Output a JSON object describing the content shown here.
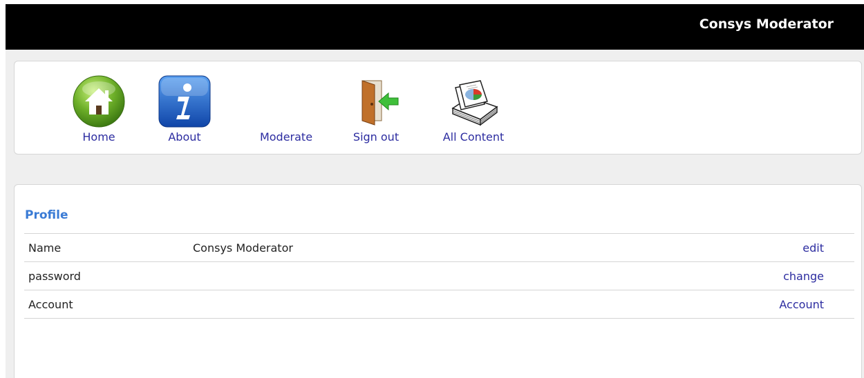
{
  "header": {
    "user_name": "Consys Moderator"
  },
  "nav": {
    "items": [
      {
        "label": "Home",
        "icon": "home-icon"
      },
      {
        "label": "About",
        "icon": "info-icon"
      },
      {
        "label": "Moderate",
        "icon": ""
      },
      {
        "label": "Sign out",
        "icon": "exit-door-icon"
      },
      {
        "label": "All Content",
        "icon": "documents-stack-icon"
      }
    ]
  },
  "profile": {
    "title": "Profile",
    "rows": [
      {
        "field": "Name",
        "value": "Consys Moderator",
        "action": "edit"
      },
      {
        "field": "password",
        "value": "",
        "action": "change"
      },
      {
        "field": "Account",
        "value": "",
        "action": "Account"
      }
    ]
  },
  "colors": {
    "topbar": "#000000",
    "link": "#2c2ca0",
    "profile_title": "#3a7bd5",
    "background": "#efefef"
  }
}
